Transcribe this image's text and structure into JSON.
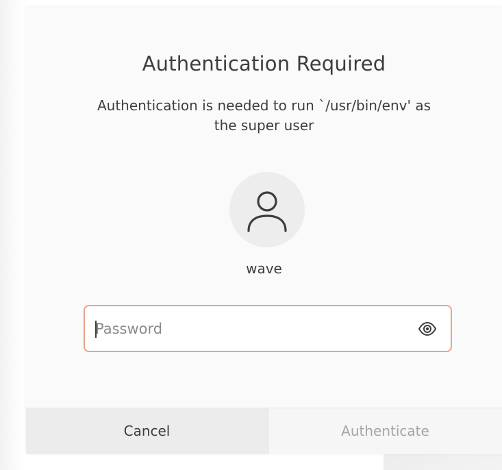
{
  "dialog": {
    "title": "Authentication Required",
    "message_line1": "Authentication is needed to run `/usr/bin/env' as",
    "message_line2": "the super user",
    "avatar_icon": "user-icon",
    "username": "wave"
  },
  "password": {
    "placeholder": "Password",
    "value": "",
    "reveal_icon": "eye-icon"
  },
  "buttons": {
    "cancel_label": "Cancel",
    "authenticate_label": "Authenticate",
    "authenticate_enabled": false
  },
  "colors": {
    "focus_border": "#e9a48a",
    "text": "#3d3d3d",
    "disabled_text": "#a5a5a5",
    "avatar_bg": "#ededed"
  }
}
